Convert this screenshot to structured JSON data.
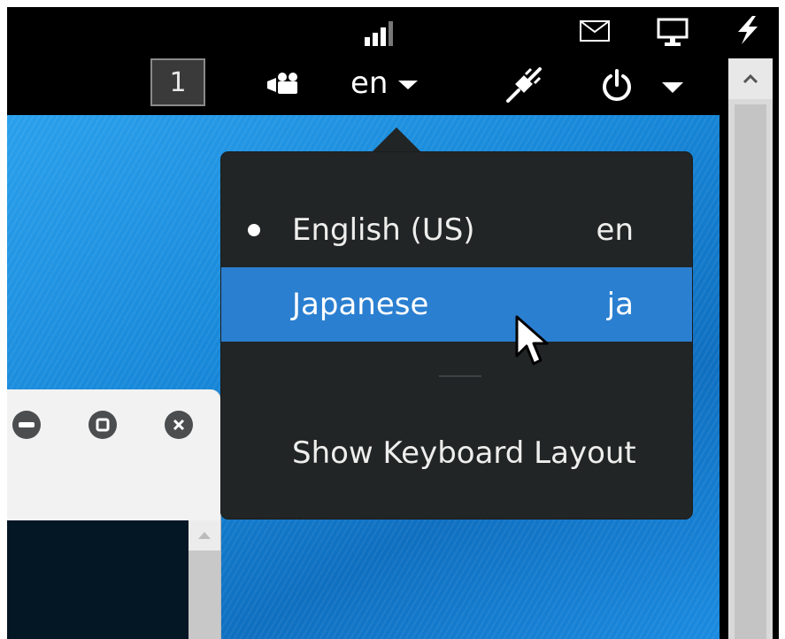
{
  "topbar": {
    "workspace_number": "1",
    "language_indicator": "en",
    "icons": [
      "signal-icon",
      "mail-icon",
      "display-icon",
      "power-bolt-icon",
      "camera-icon",
      "network-wired-icon",
      "power-icon",
      "dropdown-caret-icon"
    ]
  },
  "language_menu": {
    "items": [
      {
        "label": "English (US)",
        "code": "en",
        "active": true
      },
      {
        "label": "Japanese",
        "code": "ja",
        "highlighted": true
      }
    ],
    "show_layout_label": "Show Keyboard Layout"
  },
  "colors": {
    "menu_bg": "#212526",
    "highlight": "#2b7fd0",
    "desktop": "#1a7fd0"
  }
}
